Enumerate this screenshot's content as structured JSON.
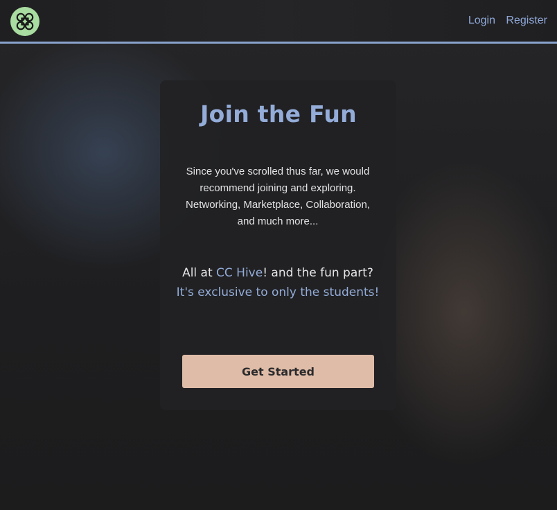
{
  "header": {
    "logo_icon": "knot-logo-icon",
    "nav": {
      "login": "Login",
      "register": "Register"
    }
  },
  "hero": {
    "title": "Join the Fun",
    "description": "Since you've scrolled thus far, we would recommend joining and exploring. Networking, Marketplace, Collaboration, and much more...",
    "line_prefix": "All at ",
    "brand": "CC Hive",
    "line_suffix": "! and the fun part?",
    "exclusive": "It's exclusive to only the students!",
    "cta_label": "Get Started"
  },
  "colors": {
    "accent": "#93acd8",
    "cta_background": "#dfbca7",
    "logo_background": "#a9dca0",
    "header_border": "#8aa3cc"
  }
}
